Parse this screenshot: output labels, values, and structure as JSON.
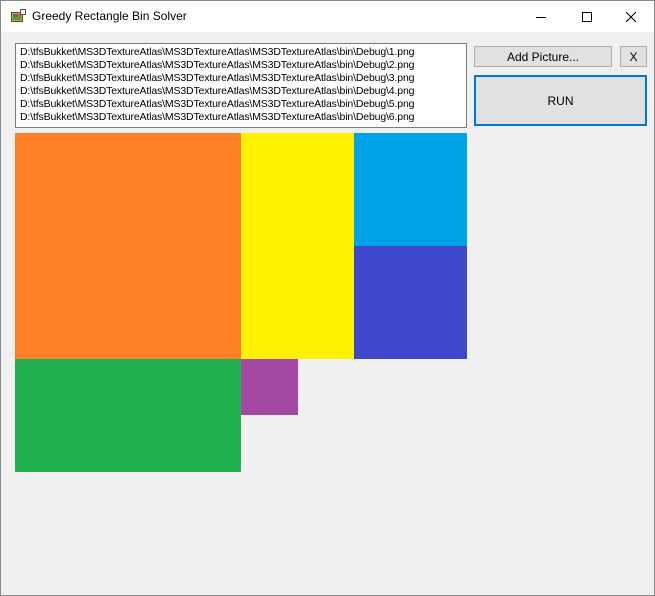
{
  "window": {
    "title": "Greedy Rectangle Bin Solver",
    "icons": {
      "app": "app-icon",
      "minimize": "minimize-icon",
      "maximize": "maximize-icon",
      "close": "close-icon"
    }
  },
  "file_list": {
    "items": [
      "D:\\tfsBukket\\MS3DTextureAtlas\\MS3DTextureAtlas\\MS3DTextureAtlas\\bin\\Debug\\1.png",
      "D:\\tfsBukket\\MS3DTextureAtlas\\MS3DTextureAtlas\\MS3DTextureAtlas\\bin\\Debug\\2.png",
      "D:\\tfsBukket\\MS3DTextureAtlas\\MS3DTextureAtlas\\MS3DTextureAtlas\\bin\\Debug\\3.png",
      "D:\\tfsBukket\\MS3DTextureAtlas\\MS3DTextureAtlas\\MS3DTextureAtlas\\bin\\Debug\\4.png",
      "D:\\tfsBukket\\MS3DTextureAtlas\\MS3DTextureAtlas\\MS3DTextureAtlas\\bin\\Debug\\5.png",
      "D:\\tfsBukket\\MS3DTextureAtlas\\MS3DTextureAtlas\\MS3DTextureAtlas\\bin\\Debug\\6.png"
    ]
  },
  "buttons": {
    "add_picture": "Add Picture...",
    "remove": "X",
    "run": "RUN"
  },
  "packed_rectangles": {
    "colors": [
      "#ff7f27",
      "#fff200",
      "#00a2e8",
      "#3f48cc",
      "#22b14c",
      "#a349a4"
    ]
  },
  "colors": {
    "window_background": "#f0f0f0",
    "accent": "#0078d7"
  }
}
